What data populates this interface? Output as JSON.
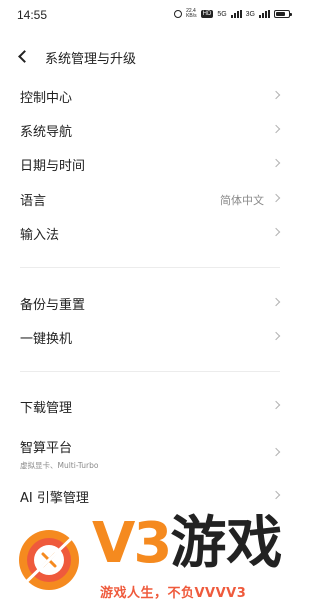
{
  "status_bar": {
    "time": "14:55",
    "speed_value": "22.4",
    "speed_unit": "KB/s",
    "hd_label": "HD",
    "network_label": "5G",
    "network2_label": "3G",
    "battery_level": 0.75
  },
  "header": {
    "title": "系统管理与升级"
  },
  "group1": [
    {
      "label": "控制中心"
    },
    {
      "label": "系统导航"
    },
    {
      "label": "日期与时间"
    },
    {
      "label": "语言",
      "value": "简体中文"
    },
    {
      "label": "输入法"
    }
  ],
  "group2": [
    {
      "label": "备份与重置"
    },
    {
      "label": "一键换机"
    }
  ],
  "group3": [
    {
      "label": "下载管理"
    },
    {
      "label": "智算平台",
      "sub": "虚拟显卡、Multi-Turbo"
    },
    {
      "label": "AI 引擎管理"
    }
  ],
  "watermark": {
    "brand_v3": "V3",
    "brand_cn": "游戏",
    "slogan": "游戏人生，不负VVVV3",
    "colors": {
      "orange": "#f58a1f",
      "red": "#ef5a3c",
      "dark": "#222222"
    }
  }
}
